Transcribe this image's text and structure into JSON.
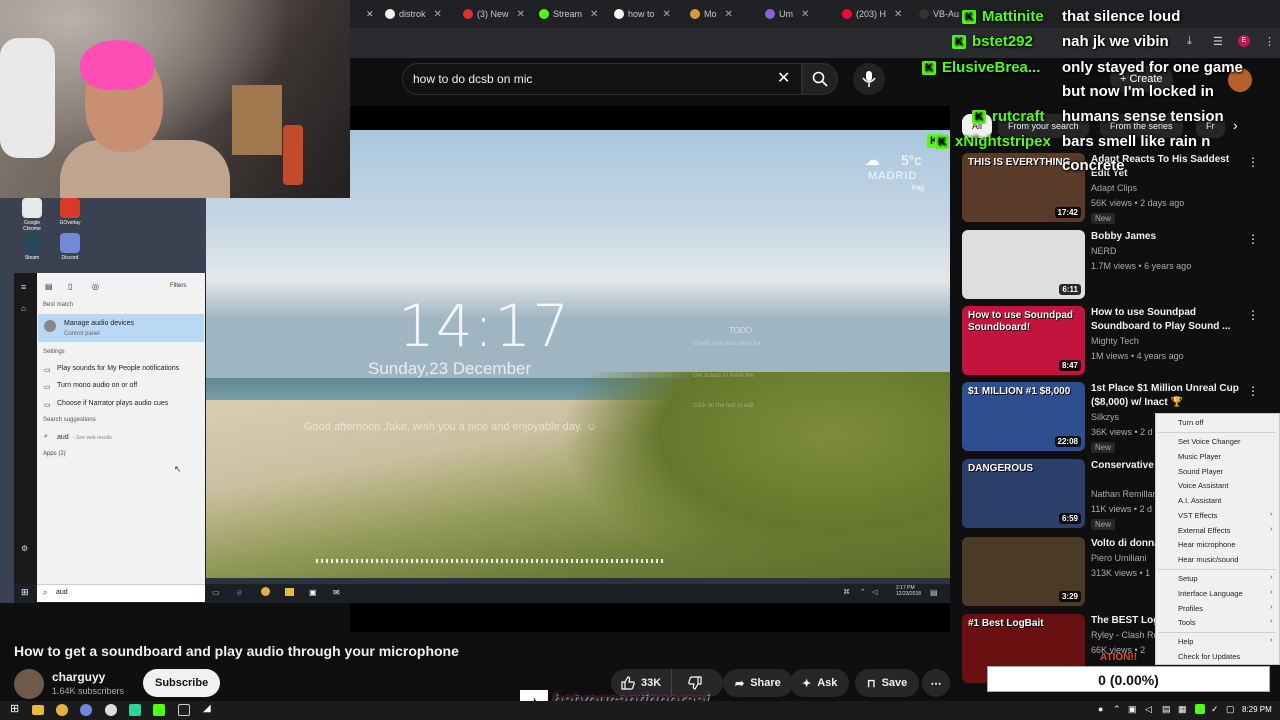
{
  "browser": {
    "tabs": [
      {
        "label": "distrok",
        "color": "#f6f6f6"
      },
      {
        "label": "(3) New",
        "color": "#e0302e"
      },
      {
        "label": "Stream",
        "color": "#53fc18"
      },
      {
        "label": "how to",
        "color": "#f6f6f6"
      },
      {
        "label": "Mo",
        "color": "#d79a3c"
      },
      {
        "label": "Um",
        "color": "#8a63d2"
      },
      {
        "label": "(203) H",
        "color": "#ff0033"
      },
      {
        "label": "VB-Au",
        "color": "#333333"
      }
    ]
  },
  "youtube": {
    "search_value": "how to do dcsb on mic",
    "create_label": "Create",
    "chips": [
      "All",
      "From your search",
      "From the series",
      "Fr"
    ],
    "video": {
      "title": "How to get a soundboard and play audio through your microphone",
      "channel": "charguyy",
      "subscribers": "1.64K subscribers",
      "subscribe_label": "Subscribe",
      "likes": "33K",
      "share_label": "Share",
      "ask_label": "Ask",
      "save_label": "Save"
    },
    "recommendations": [
      {
        "title": "Adapt Reacts To His Saddest Edit Yet",
        "channel": "Adapt Clips",
        "meta": "56K views • 2 days ago",
        "badge": "New",
        "duration": "17:42",
        "thumb": "#5a3b2a",
        "thumb_text": "THIS IS EVERYTHING"
      },
      {
        "title": "Bobby James",
        "channel": "NERD",
        "meta": "1.7M views • 6 years ago",
        "badge": "",
        "duration": "6:11",
        "thumb": "#dedede",
        "thumb_text": ""
      },
      {
        "title": "How to use Soundpad Soundboard to Play Sound ...",
        "channel": "Mighty Tech",
        "meta": "1M views • 4 years ago",
        "badge": "",
        "duration": "8:47",
        "thumb": "#c3143d",
        "thumb_text": "How to use Soundpad Soundboard!"
      },
      {
        "title": "1st Place $1 Million Unreal Cup ($8,000) w/ Inact 🏆",
        "channel": "Silkzys",
        "meta": "36K views • 2 d",
        "badge": "New",
        "duration": "22:08",
        "thumb": "#2d4f8f",
        "thumb_text": "$1 MILLION #1 $8,000"
      },
      {
        "title": "Conservative W Withers Speec",
        "channel": "Nathan Remillar",
        "meta": "11K views • 2 d",
        "badge": "New",
        "duration": "6:59",
        "thumb": "#2c3f6b",
        "thumb_text": "DANGEROUS"
      },
      {
        "title": "Volto di donna Version)",
        "channel": "Piero Umiliani",
        "meta": "313K views • 1",
        "badge": "",
        "duration": "3:29",
        "thumb": "#4a3a26",
        "thumb_text": ""
      },
      {
        "title": "The BEST Log UPGRADE in 2",
        "channel": "Ryley - Clash Ro",
        "meta": "66K views • 2",
        "badge": "",
        "duration": "",
        "thumb": "#6a1010",
        "thumb_text": "#1 Best LogBait"
      }
    ]
  },
  "desktop": {
    "clock_time": "14:17",
    "clock_date": "Sunday,23 December",
    "greeting": "Good afternoon Jake, wish you a nice and enjoyable day. ☺",
    "weather_temp": "5°c",
    "weather_city": "MADRID",
    "weather_cond": "Fog",
    "todo_title": "TODO",
    "todo_lines": [
      "Check your mail inbox for",
      "Get tickets to finish the",
      "Click on the text to edit"
    ],
    "tray_time": "2:17 PM",
    "tray_date": "12/23/2018",
    "icons": [
      {
        "label": "Google Chrome",
        "color": "#e8e8e8"
      },
      {
        "label": "GOverlay",
        "color": "#d93a2b"
      },
      {
        "label": "Steam",
        "color": "#2a475e"
      },
      {
        "label": "Discord",
        "color": "#7289da"
      }
    ],
    "start_menu": {
      "filters_label": "Filters",
      "best_match_header": "Best match",
      "best_match_title": "Manage audio devices",
      "best_match_sub": "Control panel",
      "settings_header": "Settings",
      "settings_items": [
        "Play sounds for My People notifications",
        "Turn mono audio on or off",
        "Choose if Narrator plays audio cues"
      ],
      "suggestions_header": "Search suggestions",
      "suggestion": "aud",
      "suggestion_sub": "- See web results",
      "apps_header": "Apps (2)",
      "search_typed": "aud"
    }
  },
  "soundpad_menu": {
    "items": [
      {
        "label": "Turn off",
        "arrow": false
      },
      {
        "label": "Set Voice Changer",
        "arrow": false
      },
      {
        "label": "Music Player",
        "arrow": false
      },
      {
        "label": "Sound Player",
        "arrow": false
      },
      {
        "label": "Voice Assistant",
        "arrow": false
      },
      {
        "label": "A.I. Assistant",
        "arrow": false
      },
      {
        "label": "VST Effects",
        "arrow": true
      },
      {
        "label": "External Effects",
        "arrow": true
      },
      {
        "label": "Hear microphone",
        "arrow": false
      },
      {
        "label": "Hear music/sound",
        "arrow": false
      },
      {
        "label": "Setup",
        "arrow": true
      },
      {
        "label": "Interface Language",
        "arrow": true
      },
      {
        "label": "Profiles",
        "arrow": true
      },
      {
        "label": "Tools",
        "arrow": true
      },
      {
        "label": "Help",
        "arrow": true
      },
      {
        "label": "Check for Updates",
        "arrow": false
      }
    ],
    "donation_text": "ATION!!",
    "counter": "0 (0.00%)"
  },
  "chat": [
    {
      "user": "Mattinite",
      "message": "that silence loud",
      "cont": ""
    },
    {
      "user": "bstet292",
      "message": "nah jk we vibin",
      "cont": ""
    },
    {
      "user": "ElusiveBrea...",
      "message": "only stayed for one game",
      "cont": "but now I'm locked in"
    },
    {
      "user": "rutcraft",
      "message": "humans sense tension",
      "cont": ""
    },
    {
      "user": "xNightstripex",
      "message": "bars smell like rain n",
      "cont": "concrete"
    }
  ],
  "overlay": {
    "tiktok_handle": "betyoucantignoreej"
  },
  "taskbar": {
    "time": "8:29 PM"
  }
}
